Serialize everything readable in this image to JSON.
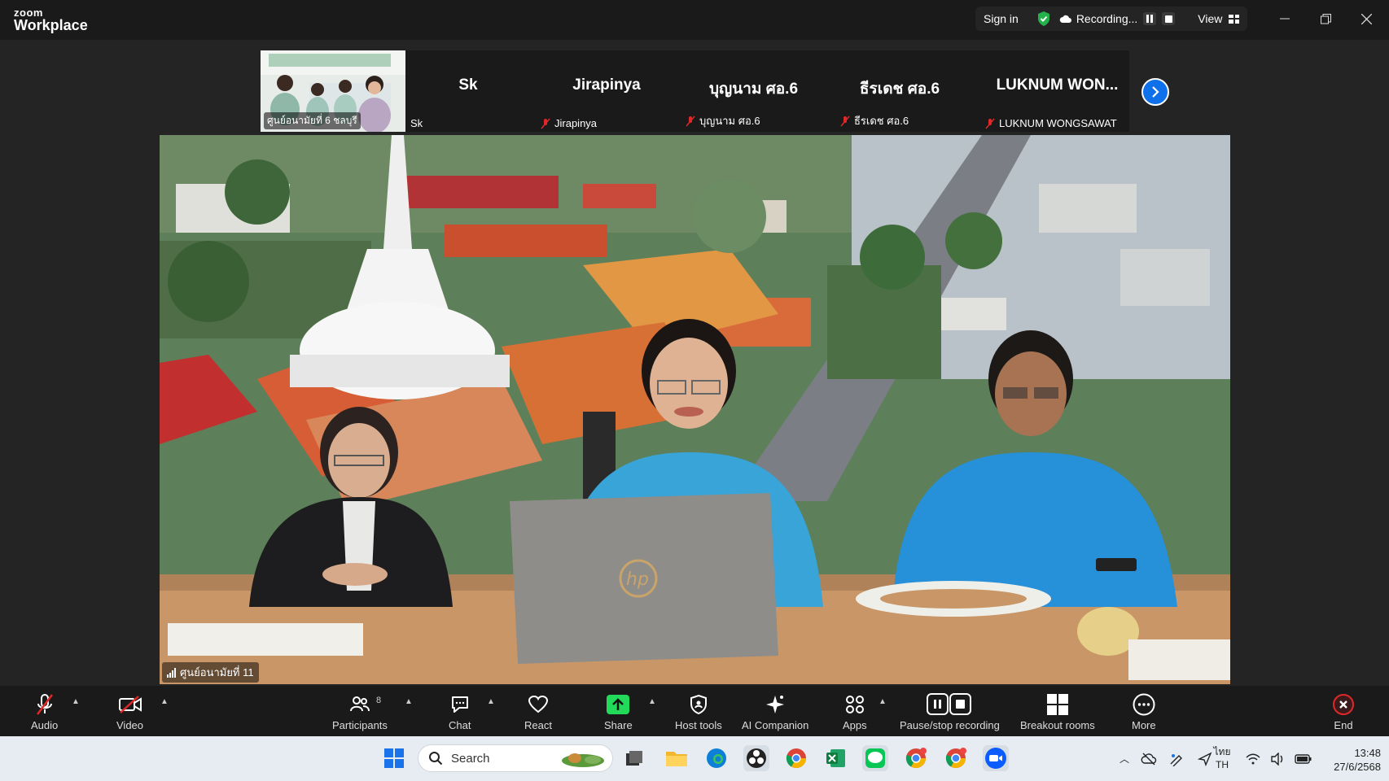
{
  "app": {
    "logo_top": "zoom",
    "logo_bottom": "Workplace"
  },
  "titlebar": {
    "signin": "Sign in",
    "recording": "Recording...",
    "view": "View",
    "icons": [
      "shield-check-icon",
      "cloud-icon",
      "pause-icon",
      "stop-icon",
      "grid-icon",
      "minimize-icon",
      "restore-icon",
      "close-icon"
    ]
  },
  "gallery": {
    "thumb_label": "ศูนย์อนามัยที่ 6 ชลบุรี",
    "tiles": [
      {
        "big": "Sk",
        "small": "Sk",
        "muted": false
      },
      {
        "big": "Jirapinya",
        "small": "Jirapinya",
        "muted": true
      },
      {
        "big": "บุญนาม ศอ.6",
        "small": "บุญนาม ศอ.6",
        "muted": true
      },
      {
        "big": "ธีรเดช ศอ.6",
        "small": "ธีรเดช ศอ.6",
        "muted": true
      },
      {
        "big": "LUKNUM WON...",
        "small": "LUKNUM WONGSAWAT",
        "muted": true
      }
    ]
  },
  "main_video": {
    "label": "ศูนย์อนามัยที่ 11",
    "laptop_brand": "hp"
  },
  "toolbar": {
    "audio": "Audio",
    "video": "Video",
    "participants": "Participants",
    "participants_count": "8",
    "chat": "Chat",
    "react": "React",
    "share": "Share",
    "host_tools": "Host tools",
    "ai_companion": "AI Companion",
    "apps": "Apps",
    "pause_stop": "Pause/stop recording",
    "breakout": "Breakout rooms",
    "more": "More",
    "end": "End"
  },
  "taskbar": {
    "search_placeholder": "Search",
    "lang_top": "ไทย",
    "lang_bottom": "TH",
    "time": "13:48",
    "date": "27/6/2568"
  },
  "colors": {
    "accent": "#0e71eb",
    "share_green": "#23d959",
    "end_red": "#e02828",
    "muted_red": "#e02828"
  }
}
